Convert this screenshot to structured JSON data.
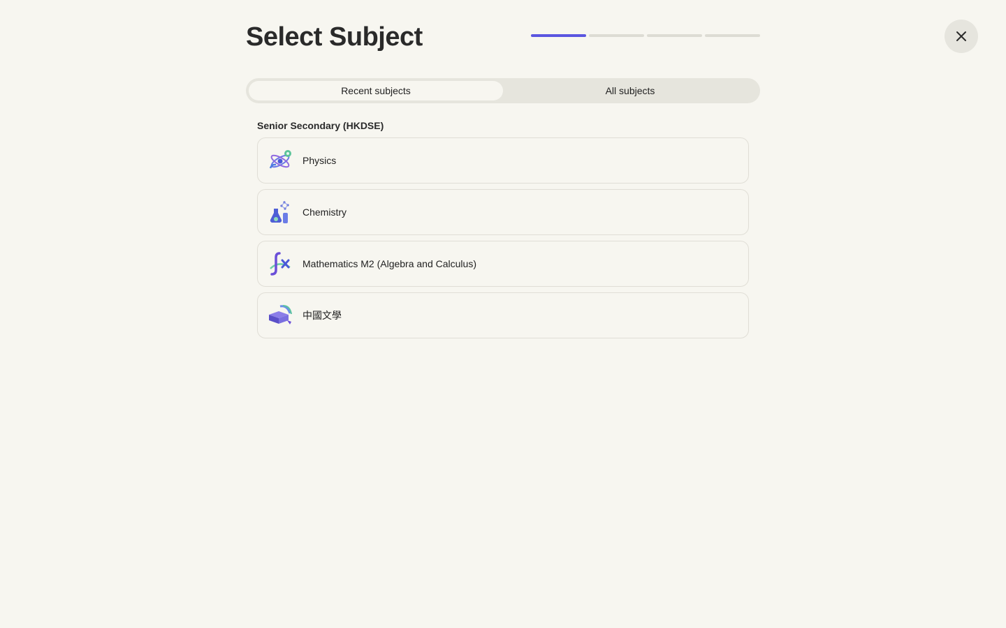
{
  "header": {
    "title": "Select Subject",
    "progress": {
      "total_steps": 4,
      "current_step": 1
    },
    "close_icon": "close-icon"
  },
  "tabs": [
    {
      "label": "Recent subjects",
      "active": true
    },
    {
      "label": "All subjects",
      "active": false
    }
  ],
  "section": {
    "label": "Senior Secondary (HKDSE)",
    "subjects": [
      {
        "label": "Physics",
        "icon": "physics-atom-icon"
      },
      {
        "label": "Chemistry",
        "icon": "chemistry-flask-icon"
      },
      {
        "label": "Mathematics M2 (Algebra and Calculus)",
        "icon": "math-function-icon"
      },
      {
        "label": "中國文學",
        "icon": "books-icon"
      }
    ]
  },
  "colors": {
    "background": "#f7f6f0",
    "accent": "#5b56e0",
    "progress_inactive": "#dddcd4",
    "tab_track": "#e6e5dd"
  }
}
